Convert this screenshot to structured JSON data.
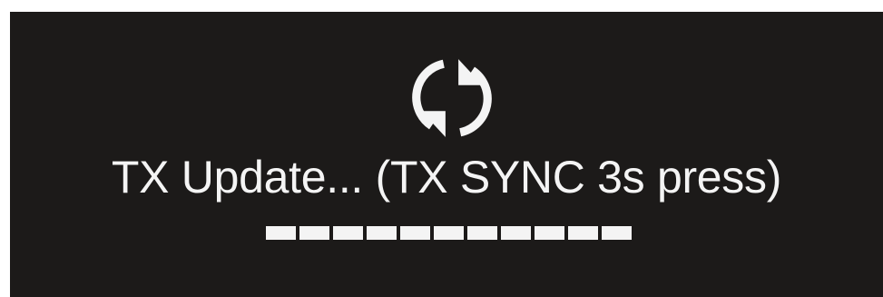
{
  "display": {
    "icon": "sync-icon",
    "status_text": "TX Update... (TX SYNC 3s press)"
  },
  "progress": {
    "segments": 11,
    "filled_fraction": 1.0
  },
  "colors": {
    "screen_background": "#1c1a19",
    "foreground": "#f4f4f4"
  }
}
